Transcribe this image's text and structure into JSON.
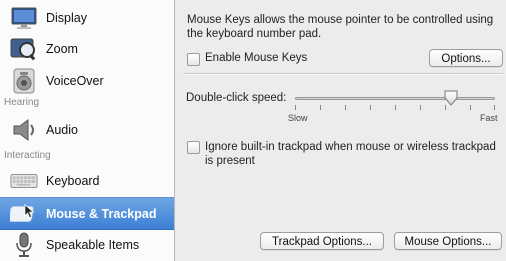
{
  "sidebar": {
    "items": [
      {
        "label": "Display",
        "icon": "display-icon"
      },
      {
        "label": "Zoom",
        "icon": "zoom-icon"
      },
      {
        "label": "VoiceOver",
        "icon": "voiceover-icon"
      },
      {
        "label": "Audio",
        "icon": "speaker-icon"
      },
      {
        "label": "Keyboard",
        "icon": "keyboard-icon"
      },
      {
        "label": "Mouse & Trackpad",
        "icon": "mouse-icon",
        "selected": true
      },
      {
        "label": "Speakable Items",
        "icon": "microphone-icon"
      }
    ],
    "sections": {
      "hearing": "Hearing",
      "interacting": "Interacting"
    }
  },
  "main": {
    "description": "Mouse Keys allows the mouse pointer to be controlled using the keyboard number pad.",
    "enable_mouse_keys": {
      "label": "Enable Mouse Keys",
      "checked": false
    },
    "options_button": "Options...",
    "double_click": {
      "label": "Double-click speed:",
      "slow_label": "Slow",
      "fast_label": "Fast",
      "value": 0.78
    },
    "ignore_trackpad": {
      "label": "Ignore built-in trackpad when mouse or wireless trackpad is present",
      "checked": false
    },
    "trackpad_options_button": "Trackpad Options...",
    "mouse_options_button": "Mouse Options..."
  },
  "colors": {
    "selection": "#3d7fd5",
    "sidebar_bg": "#fbfbfb",
    "pane_bg": "#ececec"
  }
}
